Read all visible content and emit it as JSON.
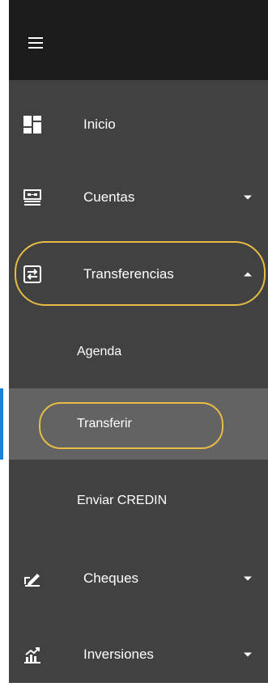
{
  "menu": {
    "toggle_icon": "hamburger-menu-icon",
    "items": [
      {
        "label": "Inicio",
        "icon": "dashboard-grid-icon",
        "expanded": null
      },
      {
        "label": "Cuentas",
        "icon": "account-card-icon",
        "expanded": false
      },
      {
        "label": "Transferencias",
        "icon": "transfer-arrows-icon",
        "expanded": true
      },
      {
        "label": "Cheques",
        "icon": "cheque-pen-icon",
        "expanded": false
      },
      {
        "label": "Inversiones",
        "icon": "investment-chart-icon",
        "expanded": false
      }
    ],
    "transferencias_sub": [
      {
        "label": "Agenda",
        "active": false
      },
      {
        "label": "Transferir",
        "active": true
      },
      {
        "label": "Enviar CREDIN",
        "active": false
      }
    ]
  },
  "colors": {
    "sidebar_bg": "#414141",
    "topbar_bg": "#1c1c1c",
    "active_bg": "#636363",
    "active_indicator": "#1e7fd6",
    "highlight": "#e6bc45",
    "text": "#ffffff"
  }
}
